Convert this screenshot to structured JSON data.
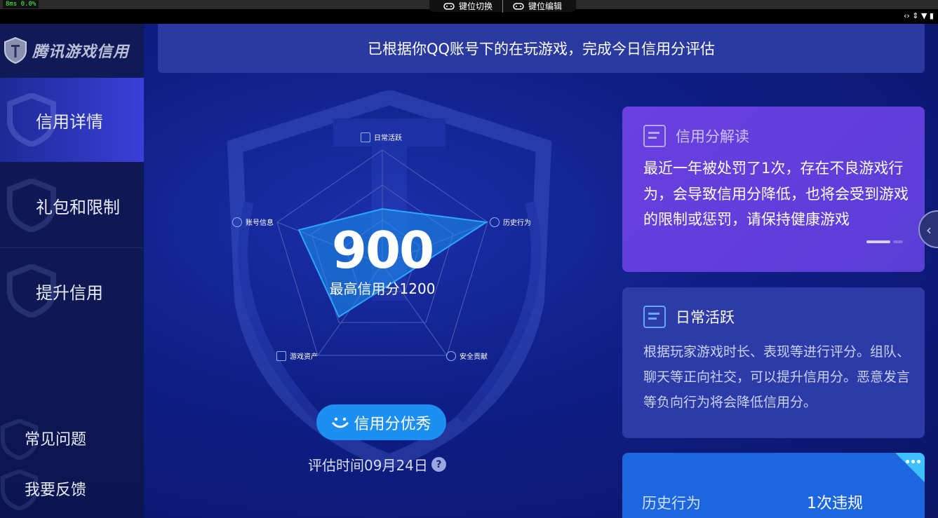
{
  "top": {
    "perf": "8ms  0.0%",
    "key_switch": "键位切换",
    "key_edit": "键位编辑",
    "status_icons": "‹› ⇕ ▼ ▮"
  },
  "sidebar": {
    "logo": "腾讯游戏信用",
    "items": [
      {
        "label": "信用详情"
      },
      {
        "label": "礼包和限制"
      },
      {
        "label": "提升信用"
      }
    ],
    "footer": [
      {
        "label": "常见问题"
      },
      {
        "label": "我要反馈"
      }
    ]
  },
  "banner": "已根据你QQ账号下的在玩游戏，完成今日信用分评估",
  "radar": {
    "axes": [
      "日常活跃",
      "历史行为",
      "安全贡献",
      "游戏资产",
      "账号信息"
    ],
    "score": "900",
    "max_label": "最高信用分1200"
  },
  "rating_button": "信用分优秀",
  "eval_time": "评估时间09月24日",
  "help_icon": "?",
  "card_reading": {
    "title": "信用分解读",
    "body": "最近一年被处罚了1次，存在不良游戏行为，会导致信用分降低，也将会受到游戏的限制或惩罚，请保持健康游戏"
  },
  "card_daily": {
    "title": "日常活跃",
    "body": "根据玩家游戏时长、表现等进行评分。组队、聊天等正向社交，可以提升信用分。恶意发言等负向行为将会降低信用分。"
  },
  "card_history": {
    "label": "历史行为",
    "value": "1次违规",
    "corner": "•••"
  },
  "colors": {
    "accent": "#1d8ef2",
    "card_purple": "#6a3fe0",
    "card_blue": "#2c3ba8",
    "card_history": "#1c66e0"
  }
}
